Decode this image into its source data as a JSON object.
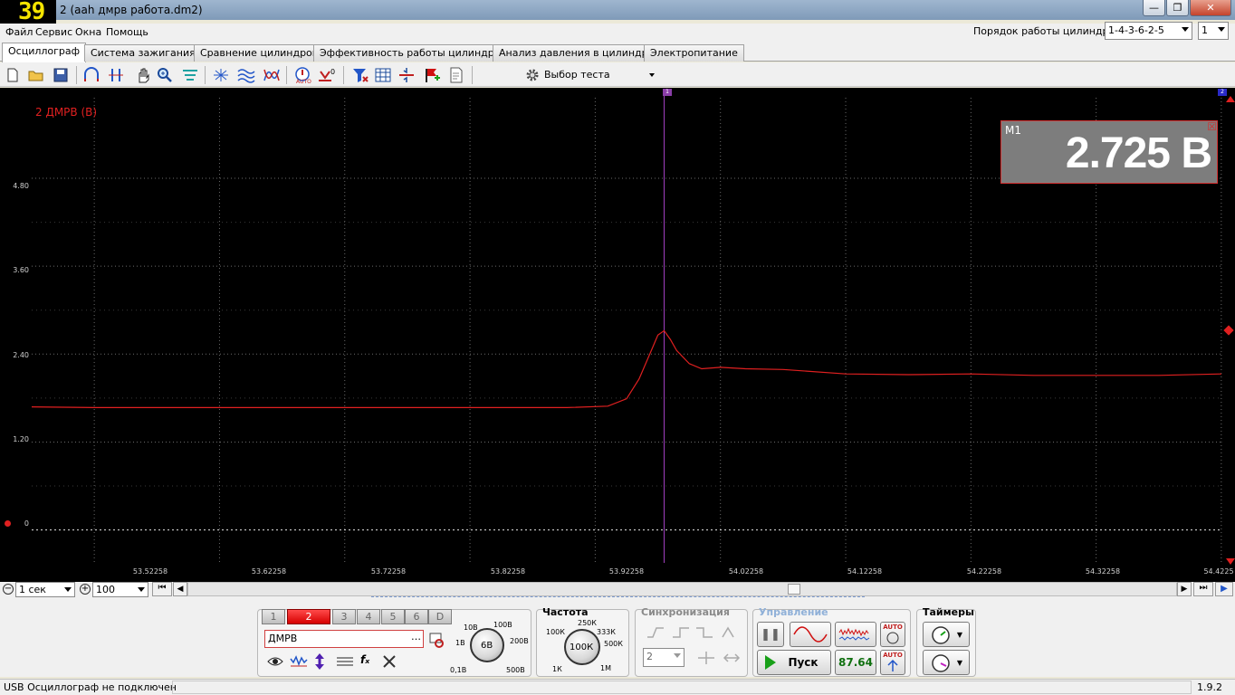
{
  "window": {
    "counter_badge": "39",
    "title": "2 (aah дмрв работа.dm2)"
  },
  "menu": [
    "Файл",
    "Сервис",
    "Окна",
    "Помощь"
  ],
  "cylinder_order": {
    "label": "Порядок работы цилиндров",
    "value": "1-4-3-6-2-5",
    "spin_value": "1"
  },
  "tabs": [
    "Осциллограф",
    "Система зажигания",
    "Сравнение цилиндров",
    "Эффективность работы цилиндров",
    "Анализ давления в цилиндре",
    "Электропитание"
  ],
  "active_tab": 0,
  "toolbar": {
    "test_select": "Выбор теста",
    "icons": [
      "new-file-icon",
      "open-folder-icon",
      "save-icon",
      "cursor-trigger-icon",
      "cursor-measure-icon",
      "hand-pan-icon",
      "zoom-icon",
      "filter-icon",
      "spectrum-icon",
      "waves-icon",
      "lissajous-icon",
      "auto-icon",
      "zero-icon",
      "filter-funnel-icon",
      "grid-icon",
      "split-icon",
      "flag-icon",
      "notes-icon"
    ]
  },
  "scope": {
    "channel_label": "2 ДМРВ (В)",
    "cursor_marker_1": "1",
    "cursor_marker_2": "2",
    "measurement": {
      "label": "M1",
      "value": "2.725 В"
    },
    "y_ticks": [
      "4.80",
      "3.60",
      "2.40",
      "1.20",
      "0"
    ],
    "x_ticks": [
      "53.52258",
      "53.62258",
      "53.72258",
      "53.82258",
      "53.92258",
      "54.02258",
      "54.12258",
      "54.22258",
      "54.32258",
      "54.4225"
    ]
  },
  "chart_data": {
    "type": "line",
    "title": "",
    "ylabel": "2 ДМРВ (В)",
    "xlim": [
      53.4726,
      54.4226
    ],
    "ylim": [
      -0.45,
      5.9
    ],
    "grid": true,
    "cursor_x": 53.9776,
    "cursor_value": 2.725,
    "series": [
      {
        "name": "2 ДМРВ (В)",
        "color": "#e02020",
        "x": [
          53.4726,
          53.5226,
          53.6226,
          53.7226,
          53.8226,
          53.9,
          53.9326,
          53.9476,
          53.9576,
          53.9676,
          53.9726,
          53.9776,
          53.9826,
          53.9876,
          53.9976,
          54.0076,
          54.0226,
          54.0426,
          54.0726,
          54.1226,
          54.1726,
          54.2226,
          54.2726,
          54.3226,
          54.3726,
          54.4226
        ],
        "values": [
          1.68,
          1.67,
          1.67,
          1.67,
          1.67,
          1.67,
          1.69,
          1.79,
          2.06,
          2.46,
          2.66,
          2.72,
          2.6,
          2.45,
          2.27,
          2.2,
          2.22,
          2.2,
          2.19,
          2.13,
          2.12,
          2.13,
          2.11,
          2.11,
          2.11,
          2.13
        ]
      }
    ]
  },
  "timebase": {
    "time_value": "1 сек",
    "zoom_value": "100"
  },
  "channel_panel": {
    "buttons": [
      "1",
      "2",
      "3",
      "4",
      "5",
      "6",
      "D"
    ],
    "selected": "2",
    "sensor_name": "ДМРВ",
    "range_knob": "6В",
    "range_labels": [
      "10В",
      "100В",
      "1В",
      "200В",
      "0,1В",
      "500В"
    ]
  },
  "frequency_panel": {
    "title": "Частота",
    "knob": "100К",
    "labels": [
      "250К",
      "100К",
      "333К",
      "500К",
      "1К",
      "1М"
    ]
  },
  "sync_panel": {
    "title": "Синхронизация",
    "channel": "2"
  },
  "control_panel": {
    "title": "Управление",
    "start_label": "Пуск",
    "rate_value": "87.64",
    "auto_label": "AUTO"
  },
  "timers_panel": {
    "title": "Таймеры"
  },
  "status": {
    "connection": "USB Осциллограф не подключен",
    "version": "1.9.2"
  }
}
